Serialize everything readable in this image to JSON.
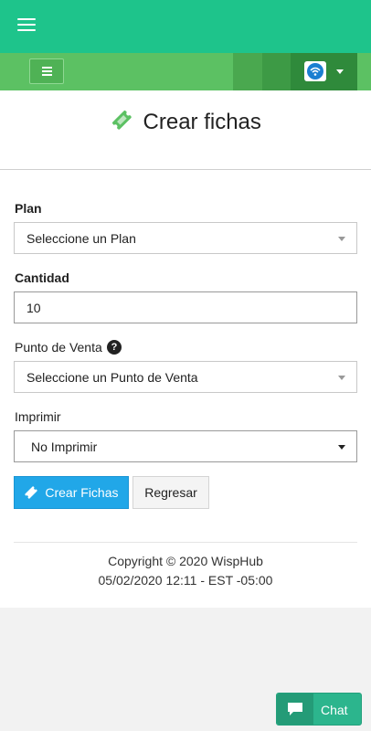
{
  "header": {
    "menu_icon": "hamburger-icon",
    "color": "#1ec48b"
  },
  "subheader": {
    "color": "#5cc163",
    "menu_icon": "hamburger-icon",
    "user_logo": "wifi-logo-icon"
  },
  "page": {
    "title": "Crear fichas",
    "title_icon": "ticket-icon"
  },
  "form": {
    "plan": {
      "label": "Plan",
      "value": "Seleccione un Plan"
    },
    "cantidad": {
      "label": "Cantidad",
      "value": "10"
    },
    "punto_venta": {
      "label": "Punto de Venta",
      "value": "Seleccione un Punto de Venta",
      "help_icon": "question-icon"
    },
    "imprimir": {
      "label": "Imprimir",
      "value": "No Imprimir"
    }
  },
  "buttons": {
    "create": "Crear Fichas",
    "back": "Regresar",
    "primary_color": "#21a7e8"
  },
  "footer": {
    "copyright": "Copyright © 2020 WispHub",
    "timestamp": "05/02/2020 12:11 - EST -05:00"
  },
  "chat": {
    "label": "Chat",
    "icon": "chat-bubble-icon",
    "color": "#2cb58d"
  }
}
